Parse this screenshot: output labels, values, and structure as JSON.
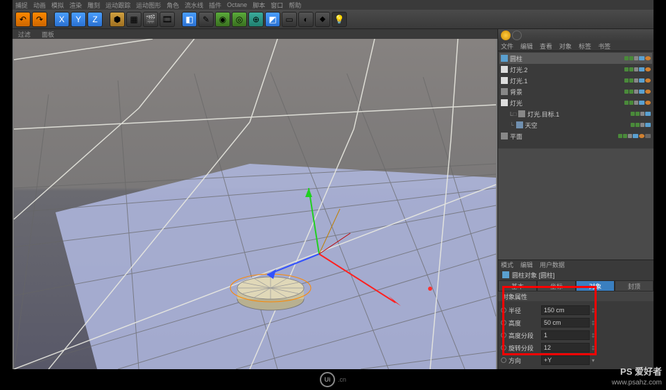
{
  "menubar": [
    "捕捉",
    "动画",
    "模拟",
    "渲染",
    "雕刻",
    "运动跟踪",
    "运动图形",
    "角色",
    "流水线",
    "插件",
    "Octane",
    "脚本",
    "窗口",
    "帮助"
  ],
  "toolbar": {
    "axis_x": "X",
    "axis_y": "Y",
    "axis_z": "Z"
  },
  "viewport_menu": [
    "过滤",
    "面板"
  ],
  "obj_tabs": [
    "文件",
    "编辑",
    "查看",
    "对象",
    "标签",
    "书签"
  ],
  "tree": [
    {
      "label": "圆柱",
      "selected": true,
      "icon": "#5aa0d0"
    },
    {
      "label": "灯光.2",
      "icon": "#ddd"
    },
    {
      "label": "灯光.1",
      "icon": "#ddd"
    },
    {
      "label": "背景",
      "icon": "#888"
    },
    {
      "label": "灯光",
      "icon": "#ddd"
    },
    {
      "label": "灯光.目标.1",
      "icon": "#888",
      "indent": true,
      "prefix": "L□"
    },
    {
      "label": "天空",
      "icon": "#7090b0",
      "indent": true,
      "prefix": "└"
    },
    {
      "label": "平面",
      "icon": "#888",
      "extra": true
    }
  ],
  "attr_header": [
    "模式",
    "编辑",
    "用户数据"
  ],
  "attr_title": "圆柱对象 [圆柱]",
  "attr_tabs": [
    {
      "label": "基本",
      "active": false
    },
    {
      "label": "坐标",
      "active": false
    },
    {
      "label": "对象",
      "active": true
    },
    {
      "label": "封顶",
      "active": false
    }
  ],
  "attr_section": "对象属性",
  "attrs": [
    {
      "label": "半径",
      "value": "150 cm",
      "spinner": "‡"
    },
    {
      "label": "高度",
      "value": "50 cm",
      "spinner": "‡"
    },
    {
      "label": "高度分段",
      "value": "1",
      "spinner": "‡"
    },
    {
      "label": "旋转分段",
      "value": "12",
      "spinner": "‡"
    },
    {
      "label": "方向",
      "value": "+Y",
      "spinner": "▾"
    }
  ],
  "watermark": {
    "main": "PS 爱好者",
    "sub": "www.psahz.com"
  },
  "footer": {
    "logo": "Ui",
    "suffix": ".cn"
  }
}
